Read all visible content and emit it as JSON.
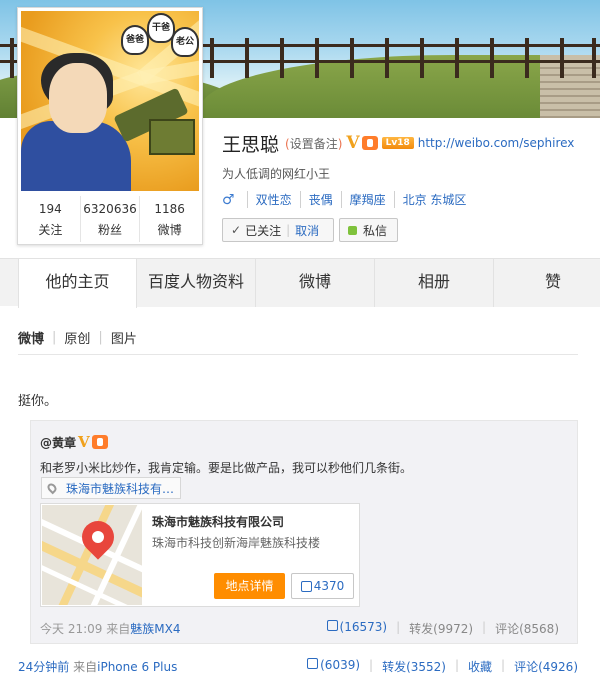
{
  "profile": {
    "name": "王思聪",
    "set_note": "设置备注",
    "v_badge": "V",
    "level": "Lv18",
    "url": "http://weibo.com/sephirex",
    "bio": "为人低调的网红小王",
    "gender_symbol": "♂",
    "tags": [
      "双性恋",
      "丧偶",
      "摩羯座",
      "北京 东城区"
    ],
    "followed_label": "已关注",
    "cancel_label": "取消",
    "message_label": "私信",
    "avatar_ghosts": [
      "爸爸",
      "干爸",
      "老公"
    ]
  },
  "stats": [
    {
      "num": "194",
      "label": "关注"
    },
    {
      "num": "6320636",
      "label": "粉丝"
    },
    {
      "num": "1186",
      "label": "微博"
    }
  ],
  "tabs": [
    "他的主页",
    "百度人物资料",
    "微博",
    "相册",
    "赞"
  ],
  "subnav": [
    "微博",
    "原创",
    "图片"
  ],
  "post": {
    "text": "挺你。",
    "repost": {
      "author": "@黄章",
      "v_badge": "V",
      "text": "和老罗小米比炒作，我肯定输。要是比做产品，我可以秒他们几条街。",
      "location_chip": "珠海市魅族科技有…",
      "place_name": "珠海市魅族科技有限公司",
      "place_address": "珠海市科技创新海岸魅族科技楼",
      "detail_label": "地点详情",
      "place_likes": "4370",
      "time": "今天 21:09",
      "from_prefix": "来自",
      "source": "魅族MX4",
      "likes": "(16573)",
      "repost_label": "转发(9972)",
      "comment_label": "评论(8568)"
    },
    "time": "24分钟前",
    "from_prefix": "来自",
    "source": "iPhone 6 Plus",
    "likes": "(6039)",
    "repost_label": "转发(3552)",
    "fav_label": "收藏",
    "comment_label": "评论(4926)"
  }
}
